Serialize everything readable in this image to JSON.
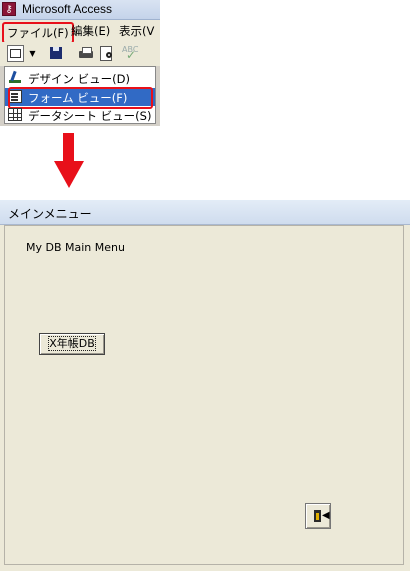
{
  "access": {
    "title": "Microsoft Access",
    "menus": {
      "file": "ファイル(F)",
      "edit": "編集(E)",
      "view": "表示(V"
    },
    "view_menu": {
      "design": "デザイン ビュー(D)",
      "form": "フォーム ビュー(F)",
      "datasheet": "データシート ビュー(S)"
    }
  },
  "form": {
    "window_title": "メインメニュー",
    "label": "My DB Main Menu",
    "button_label": "X年帳DB"
  },
  "colors": {
    "highlight": "#316ac5",
    "annotation_red": "#e8101a",
    "form_bg": "#ece9d8"
  }
}
